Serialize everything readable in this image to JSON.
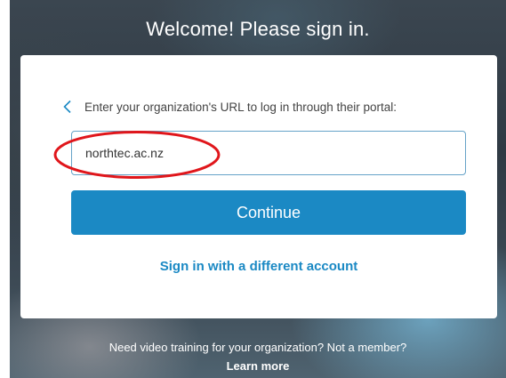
{
  "header": {
    "title": "Welcome! Please sign in."
  },
  "card": {
    "back_icon": "chevron-left-icon",
    "prompt": "Enter your organization's URL to log in through their portal:",
    "url_input": {
      "value": "northtec.ac.nz",
      "placeholder": ""
    },
    "continue_label": "Continue",
    "different_account_label": "Sign in with a different account"
  },
  "footer": {
    "text": "Need video training for your organization? Not a member?",
    "learn_more_label": "Learn more"
  },
  "colors": {
    "accent": "#1b89c4",
    "annotation": "#e0161b",
    "input_border": "#66a3c8"
  }
}
